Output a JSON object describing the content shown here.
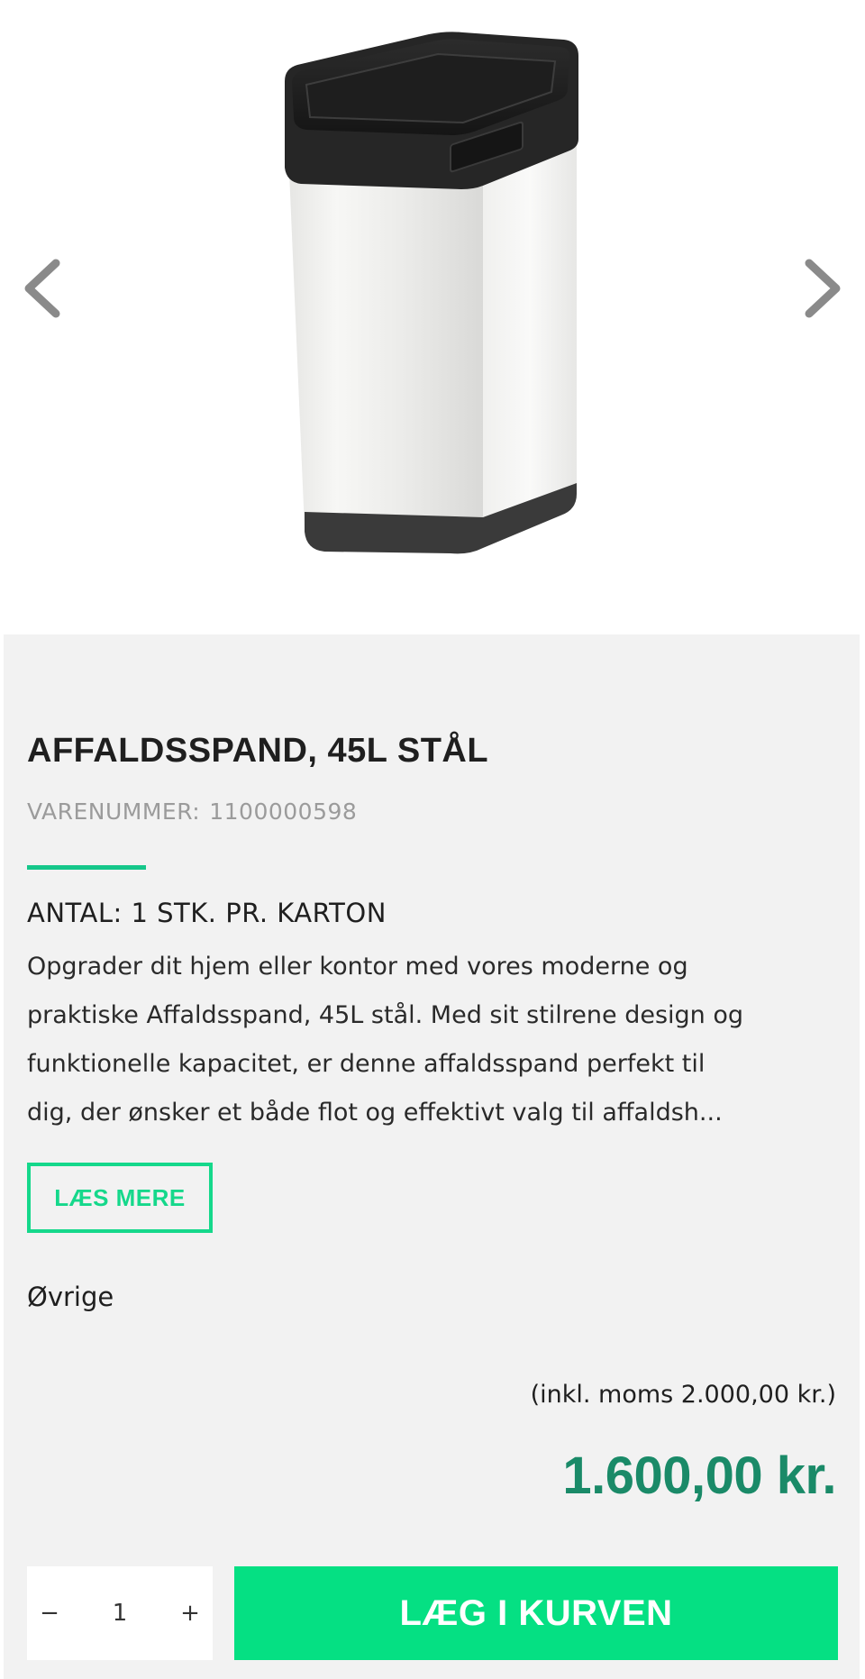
{
  "gallery": {
    "prev_icon": "chevron-left-icon",
    "next_icon": "chevron-right-icon",
    "image_alt": "Affaldsspand, 45L stål"
  },
  "product": {
    "title": "AFFALDSSPAND, 45L STÅL",
    "sku_label": "VARENUMMER:",
    "sku_value": "1100000598",
    "quantity_line": "ANTAL: 1 STK. PR. KARTON",
    "description": "Opgrader dit hjem eller kontor med vores moderne og praktiske Affaldsspand, 45L stål. Med sit stilrene design og funktionelle kapacitet, er denne affaldsspand perfekt til dig, der ønsker et både flot og effektivt valg til affaldsh...",
    "read_more_label": "LÆS MERE",
    "category": "Øvrige",
    "vat_note": "(inkl. moms 2.000,00 kr.)",
    "price": "1.600,00 kr."
  },
  "cart": {
    "minus_label": "−",
    "quantity_value": "1",
    "plus_label": "+",
    "add_label": "LÆG I KURVEN"
  },
  "colors": {
    "accent": "#15d88b",
    "cart_button": "#05e083",
    "price": "#1a8a68",
    "panel_background": "#f2f2f2"
  }
}
